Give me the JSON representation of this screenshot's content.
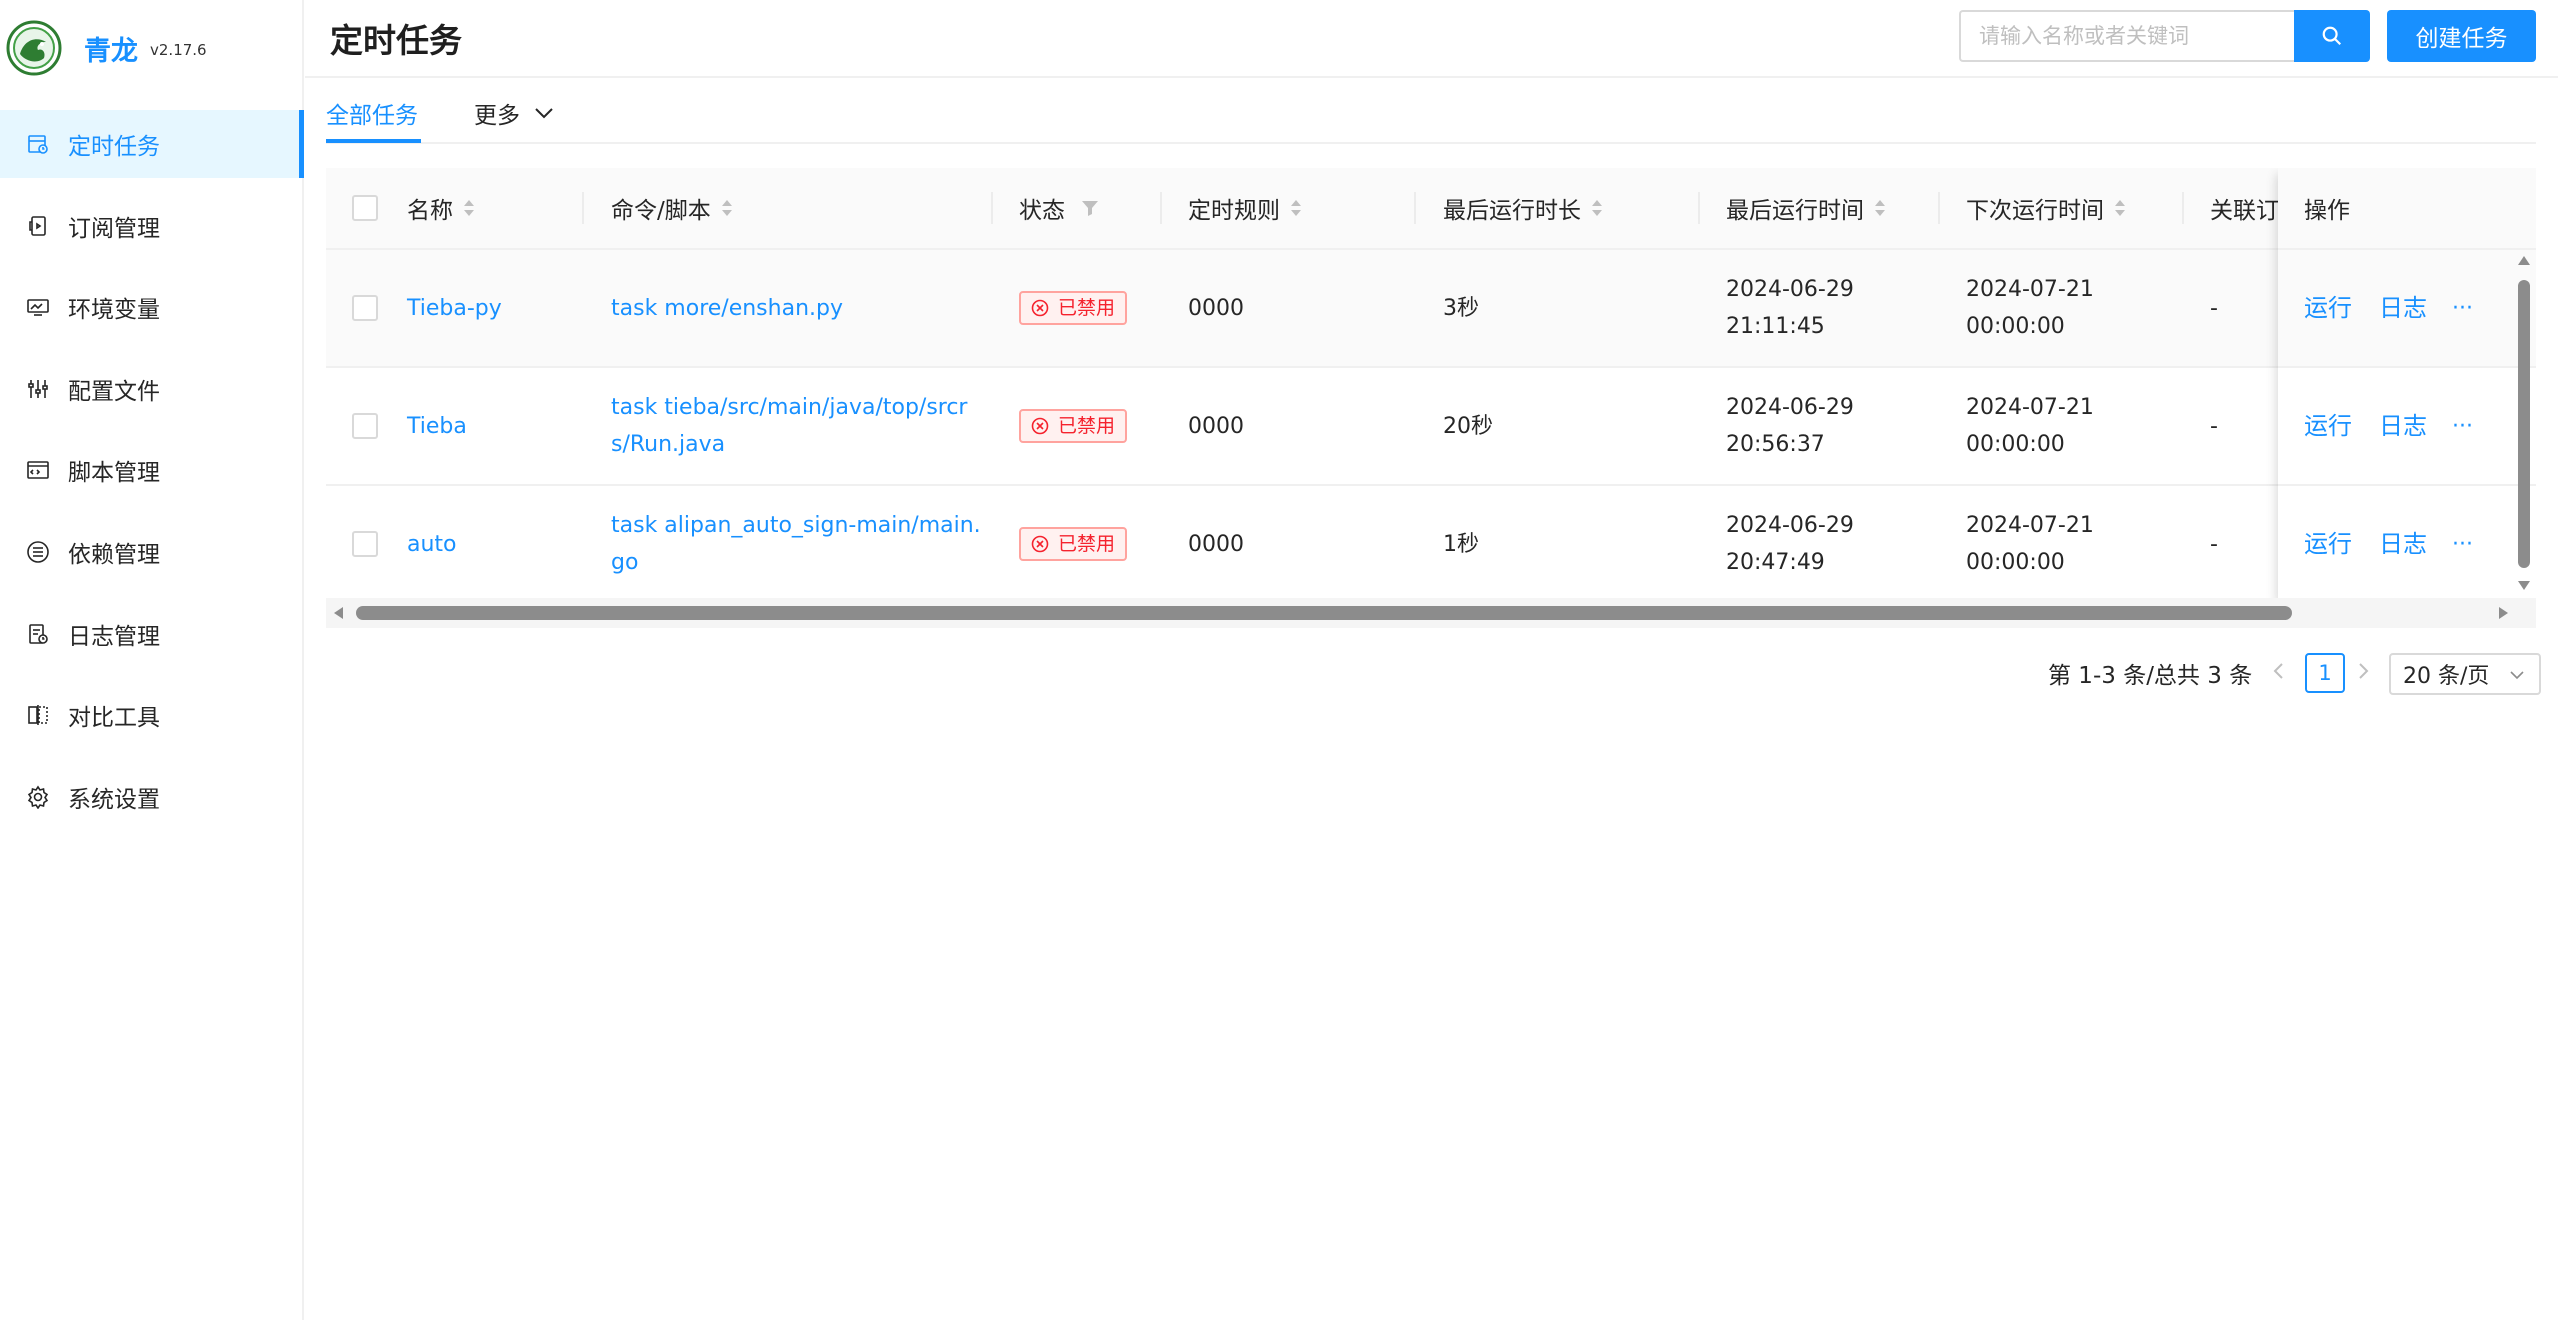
{
  "app": {
    "name": "青龙",
    "version": "v2.17.6"
  },
  "sidebar": {
    "items": [
      {
        "label": "定时任务",
        "icon": "calendar-icon",
        "active": true
      },
      {
        "label": "订阅管理",
        "icon": "subscription-icon"
      },
      {
        "label": "环境变量",
        "icon": "monitor-icon"
      },
      {
        "label": "配置文件",
        "icon": "sliders-icon"
      },
      {
        "label": "脚本管理",
        "icon": "code-window-icon"
      },
      {
        "label": "依赖管理",
        "icon": "list-icon"
      },
      {
        "label": "日志管理",
        "icon": "log-file-icon"
      },
      {
        "label": "对比工具",
        "icon": "diff-icon"
      },
      {
        "label": "系统设置",
        "icon": "gear-icon"
      }
    ]
  },
  "header": {
    "title": "定时任务",
    "search_placeholder": "请输入名称或者关键词",
    "search_value": "",
    "create_label": "创建任务",
    "primary_color": "#1890ff"
  },
  "tabs": {
    "all": "全部任务",
    "more": "更多"
  },
  "table": {
    "columns": {
      "name": "名称",
      "command": "命令/脚本",
      "status": "状态",
      "schedule": "定时规则",
      "last_duration": "最后运行时长",
      "last_run": "最后运行时间",
      "next_run": "下次运行时间",
      "subscription": "关联订",
      "actions": "操作"
    },
    "rows": [
      {
        "name": "Tieba-py",
        "command_l1": "task more/enshan.py",
        "command_l2": "",
        "status": "已禁用",
        "schedule": "0000",
        "duration": "3秒",
        "last_run_date": "2024-06-29",
        "last_run_time": "21:11:45",
        "next_run_date": "2024-07-21",
        "next_run_time": "00:00:00",
        "subscription": "-",
        "run": "运行",
        "log": "日志",
        "more": "···"
      },
      {
        "name": "Tieba",
        "command_l1": "task tieba/src/main/java/top/srcr",
        "command_l2": "s/Run.java",
        "status": "已禁用",
        "schedule": "0000",
        "duration": "20秒",
        "last_run_date": "2024-06-29",
        "last_run_time": "20:56:37",
        "next_run_date": "2024-07-21",
        "next_run_time": "00:00:00",
        "subscription": "-",
        "run": "运行",
        "log": "日志",
        "more": "···"
      },
      {
        "name": "auto",
        "command_l1": "task alipan_auto_sign-main/main.",
        "command_l2": "go",
        "status": "已禁用",
        "schedule": "0000",
        "duration": "1秒",
        "last_run_date": "2024-06-29",
        "last_run_time": "20:47:49",
        "next_run_date": "2024-07-21",
        "next_run_time": "00:00:00",
        "subscription": "-",
        "run": "运行",
        "log": "日志",
        "more": "···"
      }
    ]
  },
  "pagination": {
    "total_text": "第 1-3 条/总共 3 条",
    "current_page": "1",
    "page_size": "20 条/页"
  }
}
